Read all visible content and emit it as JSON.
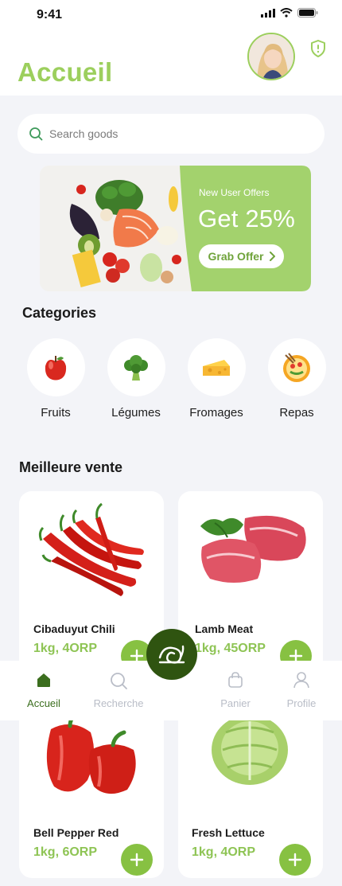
{
  "status_bar": {
    "time": "9:41"
  },
  "header": {
    "title": "Accueil"
  },
  "search": {
    "placeholder": "Search goods"
  },
  "banner": {
    "subtitle": "New User Offers",
    "headline": "Get 25%",
    "button_label": "Grab Offer",
    "accent_color": "#a3d26d"
  },
  "categories": {
    "title": "Categories",
    "items": [
      {
        "label": "Fruits",
        "icon": "apple-icon"
      },
      {
        "label": "Légumes",
        "icon": "broccoli-icon"
      },
      {
        "label": "Fromages",
        "icon": "cheese-icon"
      },
      {
        "label": "Repas",
        "icon": "meal-bowl-icon"
      }
    ]
  },
  "best_sellers": {
    "title": "Meilleure vente",
    "products": [
      {
        "name": "Cibaduyut Chili",
        "price": "1kg, 4ORP",
        "image": "chili-image"
      },
      {
        "name": "Lamb Meat",
        "price": "1kg, 45ORP",
        "image": "lamb-meat-image"
      },
      {
        "name": "Bell Pepper Red",
        "price": "1kg, 6ORP",
        "image": "bell-pepper-image"
      },
      {
        "name": "Fresh Lettuce",
        "price": "1kg, 4ORP",
        "image": "lettuce-image"
      }
    ]
  },
  "bottom_nav": {
    "items": [
      {
        "label": "Accueil",
        "icon": "home-icon",
        "active": true
      },
      {
        "label": "Recherche",
        "icon": "search-icon",
        "active": false
      },
      {
        "label": "Panier",
        "icon": "bag-icon",
        "active": false
      },
      {
        "label": "Profile",
        "icon": "user-icon",
        "active": false
      }
    ]
  },
  "colors": {
    "brand_green": "#9ccf5d",
    "button_green": "#87c142",
    "dark_green": "#2f5410",
    "background": "#f3f4f8"
  }
}
